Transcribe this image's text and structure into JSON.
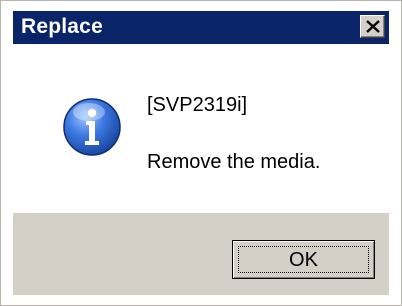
{
  "window": {
    "title": "Replace",
    "close_icon": "close-icon"
  },
  "message": {
    "icon": "info-icon",
    "code": "[SVP2319i]",
    "text": "Remove the media."
  },
  "buttons": {
    "ok_label": "OK"
  },
  "colors": {
    "titlebar": "#0a246a",
    "face": "#d4d0c8",
    "content_bg": "#ffffff",
    "icon_blue": "#2d63c8"
  }
}
